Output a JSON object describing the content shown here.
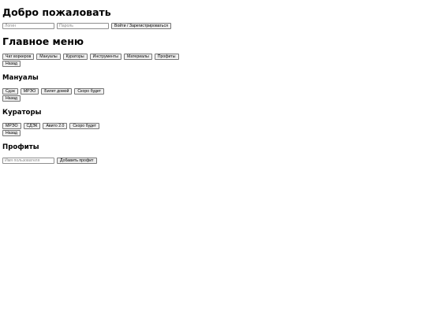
{
  "auth": {
    "title": "Добро пожаловать",
    "login_placeholder": "Логин",
    "password_placeholder": "Пароль",
    "submit_label": "Войти / Зарегистрироваться"
  },
  "main_menu": {
    "title": "Главное меню",
    "items": [
      "Чат воркеров",
      "Мануалы",
      "Кураторы",
      "Инструменты",
      "Материалы",
      "Профиты"
    ],
    "back_label": "Назад"
  },
  "manuals": {
    "title": "Мануалы",
    "items": [
      "Сдэк",
      "МРЭО",
      "Билет домой",
      "Скоро будет"
    ],
    "back_label": "Назад"
  },
  "curators": {
    "title": "Кураторы",
    "items": [
      "МРЭО",
      "СДЭК",
      "Авито 2.0",
      "Скоро будет"
    ],
    "back_label": "Назад"
  },
  "profits": {
    "title": "Профиты",
    "username_placeholder": "Имя пользователя",
    "add_label": "Добавить профит"
  }
}
